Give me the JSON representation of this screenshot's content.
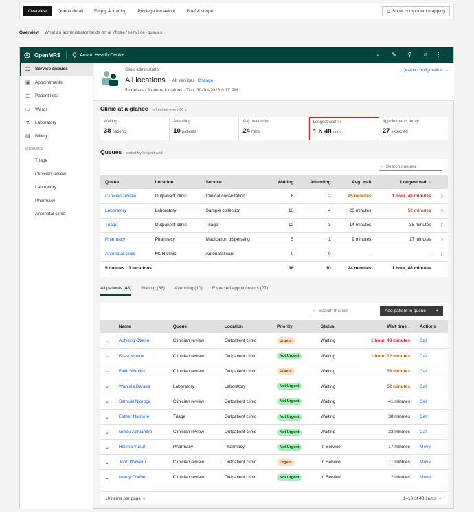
{
  "topbar": {
    "tabs": [
      "Overview",
      "Queue detail",
      "Empty & loading",
      "Privilege behaviour",
      "Brief & scope"
    ],
    "mapping_button": "Show component mapping"
  },
  "crumb": {
    "title": "Overview",
    "desc": "What an administrator lands on at",
    "path": "/home/service-queues"
  },
  "header": {
    "brand": "OpenMRS",
    "location": "Amani Health Centre"
  },
  "sidebar": {
    "items": [
      {
        "label": "Service queues",
        "icon": "users-icon"
      },
      {
        "label": "Appointments",
        "icon": "calendar-icon"
      },
      {
        "label": "Patient lists",
        "icon": "list-icon"
      },
      {
        "label": "Wards",
        "icon": "bed-icon"
      },
      {
        "label": "Laboratory",
        "icon": "flask-icon"
      },
      {
        "label": "Billing",
        "icon": "card-icon"
      }
    ],
    "section": "QUEUES",
    "queues": [
      "Triage",
      "Clinician review",
      "Laboratory",
      "Pharmacy",
      "Antenatal clinic"
    ]
  },
  "banner": {
    "role": "Clinic administrator",
    "title": "All locations",
    "all_services": "· All services",
    "change": "Change",
    "meta": "5 queues  ·  3 queue locations  ·  Thu, 30-Jul-2026 8:17 PM",
    "config": "Queue configuration →"
  },
  "glance": {
    "title": "Clinic at a glance",
    "refresh": "refreshed every 60 s",
    "tiles": [
      {
        "label": "Waiting",
        "value": "38",
        "unit": "patients"
      },
      {
        "label": "Attending",
        "value": "10",
        "unit": "patients"
      },
      {
        "label": "Avg. wait time",
        "value": "24",
        "unit": "mins"
      },
      {
        "label": "Longest wait",
        "flag": "↑↑",
        "value": "1 h 48",
        "unit": "mins"
      },
      {
        "label": "Appointments today",
        "value": "27",
        "unit": "expected"
      }
    ]
  },
  "queues": {
    "title": "Queues",
    "sort_note": "sorted by longest wait",
    "search_placeholder": "Search queues",
    "headers": [
      "Queue",
      "Location",
      "Service",
      "Waiting",
      "Attending",
      "Avg. wait",
      "Longest wait ↓"
    ],
    "rows": [
      {
        "queue": "Clinician review",
        "location": "Outpatient clinic",
        "service": "Clinical consultation",
        "waiting": "8",
        "attending": "2",
        "avg": "45 minutes",
        "longest": "1 hour, 48 minutes",
        "avg_style": "org",
        "longest_style": "red"
      },
      {
        "queue": "Laboratory",
        "location": "Laboratory",
        "service": "Sample collection",
        "waiting": "13",
        "attending": "4",
        "avg": "26 minutes",
        "longest": "52 minutes",
        "avg_style": "",
        "longest_style": "org"
      },
      {
        "queue": "Triage",
        "location": "Outpatient clinic",
        "service": "Triage",
        "waiting": "12",
        "attending": "3",
        "avg": "14 minutes",
        "longest": "38 minutes",
        "avg_style": "",
        "longest_style": ""
      },
      {
        "queue": "Pharmacy",
        "location": "Pharmacy",
        "service": "Medication dispensing",
        "waiting": "5",
        "attending": "1",
        "avg": "9 minutes",
        "longest": "17 minutes",
        "avg_style": "",
        "longest_style": ""
      },
      {
        "queue": "Antenatal clinic",
        "location": "MCH clinic",
        "service": "Antenatal care",
        "waiting": "0",
        "attending": "0",
        "avg": "--",
        "longest": "--",
        "avg_style": "",
        "longest_style": ""
      }
    ],
    "footer": {
      "label": "5 queues · 3 locations",
      "waiting": "38",
      "attending": "10",
      "avg": "24 minutes",
      "longest": "1 hour, 48 minutes"
    }
  },
  "patient_tabs": [
    "All patients (48)",
    "Waiting (38)",
    "Attending (10)",
    "Expected appointments (27)"
  ],
  "patients": {
    "search_placeholder": "Search this list",
    "add_button": "Add patient to queue",
    "headers": [
      "Name",
      "Queue",
      "Location",
      "Priority",
      "Status",
      "Wait time ↓",
      "Actions"
    ],
    "rows": [
      {
        "name": "Achieng Otieno",
        "queue": "Clinician review",
        "location": "Outpatient clinic",
        "priority": "Urgent",
        "status": "Waiting",
        "wait": "1 hour, 48 minutes",
        "action": "Call",
        "wait_style": "red"
      },
      {
        "name": "Brian Kimani",
        "queue": "Clinician review",
        "location": "Outpatient clinic",
        "priority": "Not Urgent",
        "status": "Waiting",
        "wait": "1 hour, 12 minutes",
        "action": "Call",
        "wait_style": "org"
      },
      {
        "name": "Faith Wanjiru",
        "queue": "Clinician review",
        "location": "Outpatient clinic",
        "priority": "Urgent",
        "status": "Waiting",
        "wait": "58 minutes",
        "action": "Call",
        "wait_style": "org"
      },
      {
        "name": "Wanjala Barasa",
        "queue": "Laboratory",
        "location": "Laboratory",
        "priority": "Not Urgent",
        "status": "Waiting",
        "wait": "52 minutes",
        "action": "Call",
        "wait_style": "org"
      },
      {
        "name": "Samuel Njoroge",
        "queue": "Clinician review",
        "location": "Outpatient clinic",
        "priority": "Not Urgent",
        "status": "Waiting",
        "wait": "41 minutes",
        "action": "Call",
        "wait_style": ""
      },
      {
        "name": "Esther Nabwire",
        "queue": "Triage",
        "location": "Outpatient clinic",
        "priority": "Not Urgent",
        "status": "Waiting",
        "wait": "38 minutes",
        "action": "Call",
        "wait_style": ""
      },
      {
        "name": "Grace Adhiambo",
        "queue": "Clinician review",
        "location": "Outpatient clinic",
        "priority": "Not Urgent",
        "status": "Waiting",
        "wait": "33 minutes",
        "action": "Call",
        "wait_style": ""
      },
      {
        "name": "Halima Yusuf",
        "queue": "Pharmacy",
        "location": "Pharmacy",
        "priority": "Not Urgent",
        "status": "In Service",
        "wait": "17 minutes",
        "action": "Move",
        "wait_style": ""
      },
      {
        "name": "John Waweru",
        "queue": "Clinician review",
        "location": "Outpatient clinic",
        "priority": "Urgent",
        "status": "In Service",
        "wait": "11 minutes",
        "action": "Move",
        "wait_style": ""
      },
      {
        "name": "Mercy Chebet",
        "queue": "Clinician review",
        "location": "Outpatient clinic",
        "priority": "Not Urgent",
        "status": "In Service",
        "wait": "2 minutes",
        "action": "Move",
        "wait_style": ""
      }
    ],
    "per_page": "10 items per page ⌄",
    "range": "1–10 of 48 items"
  }
}
